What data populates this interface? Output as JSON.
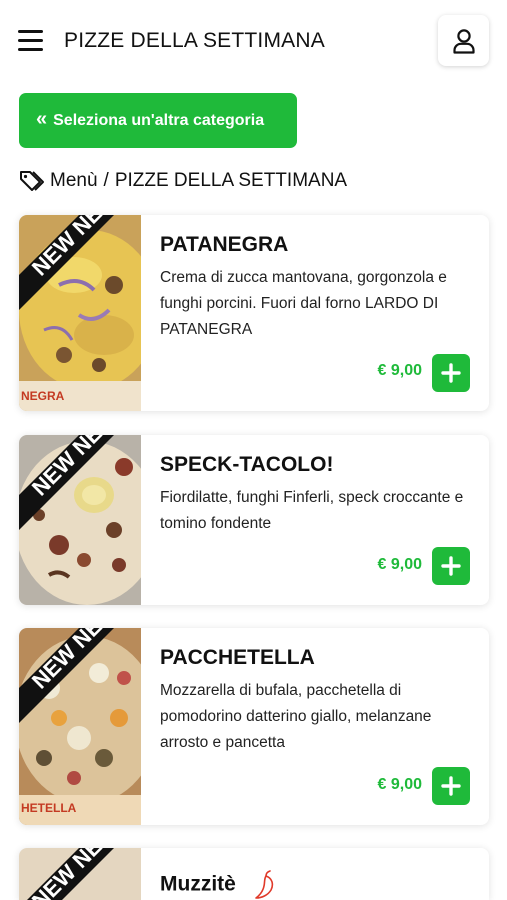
{
  "header": {
    "title": "PIZZE DELLA SETTIMANA"
  },
  "category_button": {
    "label": "Seleziona un'altra categoria"
  },
  "breadcrumb": {
    "root": "Menù",
    "separator": "/",
    "current": "PIZZE DELLA SETTIMANA"
  },
  "colors": {
    "accent": "#1fba3a",
    "text": "#111111"
  },
  "products": [
    {
      "name": "PATANEGRA",
      "description": "Crema di zucca mantovana, gorgonzola e funghi porcini. Fuori dal forno LARDO DI PATANEGRA",
      "price": "€ 9,00",
      "ribbon": "NEW NEW",
      "image_caption": "NEGRA"
    },
    {
      "name": "SPECK-TACOLO!",
      "description": "Fiordilatte, funghi Finferli, speck croccante e tomino fondente",
      "price": "€ 9,00",
      "ribbon": "NEW NEW"
    },
    {
      "name": "PACCHETELLA",
      "description": "Mozzarella di bufala, pacchetella di pomodorino datterino giallo, melanzane arrosto e pancetta",
      "price": "€ 9,00",
      "ribbon": "NEW NEW",
      "image_caption": "HETELLA"
    },
    {
      "name": "Muzzitè",
      "ribbon": "NEW NEW",
      "spicy_icon": "chili-pepper-icon"
    }
  ]
}
